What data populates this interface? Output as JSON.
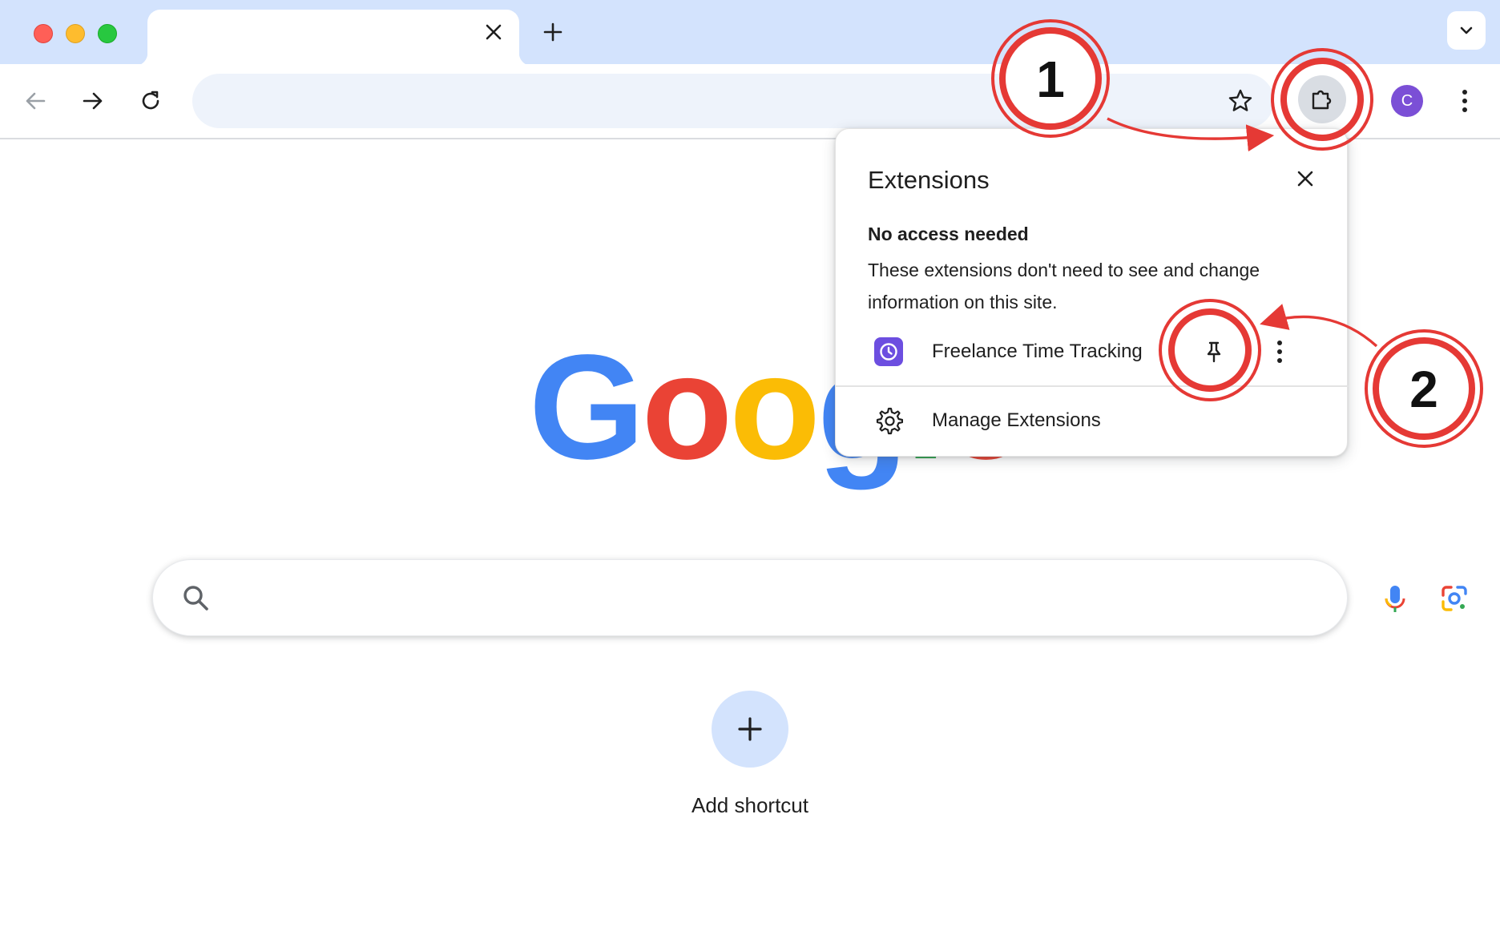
{
  "window": {
    "tab_close_icon": "close-icon",
    "new_tab_icon": "plus-icon",
    "tab_search_icon": "chevron-down-icon"
  },
  "toolbar": {
    "back_icon": "arrow-left-icon",
    "forward_icon": "arrow-right-icon",
    "reload_icon": "reload-icon",
    "omnibox_value": "",
    "bookmark_icon": "star-icon",
    "extensions_icon": "puzzle-icon",
    "avatar_initial": "C",
    "avatar_color": "#7b4fd6",
    "menu_icon": "more-vertical-icon"
  },
  "newtab": {
    "logo_text": "Google",
    "search_value": "",
    "search_icon": "search-icon",
    "voice_icon": "mic-icon",
    "lens_icon": "lens-icon",
    "add_shortcut_label": "Add shortcut"
  },
  "extensions_popup": {
    "title": "Extensions",
    "section_heading": "No access needed",
    "section_description": "These extensions don't need to see and change information on this site.",
    "extensions": [
      {
        "name": "Freelance Time Tracking",
        "icon": "clock-icon",
        "pin_icon": "pin-icon",
        "more_icon": "more-vertical-icon"
      }
    ],
    "manage_label": "Manage Extensions",
    "manage_icon": "gear-icon"
  },
  "annotations": [
    {
      "label": "1",
      "target": "extensions-button"
    },
    {
      "label": "2",
      "target": "pin-button"
    }
  ],
  "colors": {
    "annotation_red": "#e53935",
    "tabbar_bg": "#d3e3fd",
    "google_blue": "#4285f4",
    "google_red": "#ea4335",
    "google_yellow": "#fbbc05",
    "google_green": "#34a853"
  }
}
